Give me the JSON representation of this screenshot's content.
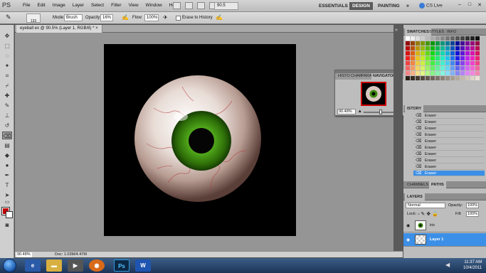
{
  "app": {
    "logo": "PS"
  },
  "menu": [
    "File",
    "Edit",
    "Image",
    "Layer",
    "Select",
    "Filter",
    "View",
    "Window",
    "Help"
  ],
  "zoom_display": "90.5",
  "workspaces": {
    "essentials": "ESSENTIALS",
    "design": "DESIGN",
    "painting": "PAINTING",
    "more": "»"
  },
  "cs_live": "CS Live",
  "window_controls": [
    "–",
    "□",
    "✕"
  ],
  "options": {
    "brush_size": "133",
    "mode_label": "Mode:",
    "mode_value": "Brush",
    "opacity_label": "Opacity:",
    "opacity_value": "16%",
    "flow_label": "Flow:",
    "flow_value": "100%",
    "erase_history_label": "Erase to History"
  },
  "document": {
    "tab_title": "eyeball ex @ 90.5% (Layer 1, RGB/8) *",
    "close": "×",
    "status_zoom": "90.48%",
    "status_doc": "Doc: 1.03M/4.47M"
  },
  "navigator": {
    "tabs": [
      "HISTO",
      "CHAR",
      "PARA",
      "NAVIGATOR"
    ],
    "zoom_value": "90.48%"
  },
  "swatches_panel": {
    "tabs": [
      "SWATCHES",
      "STYLES",
      "INFO"
    ]
  },
  "history_panel": {
    "title": "ISTORY",
    "items": [
      "Eraser",
      "Eraser",
      "Eraser",
      "Eraser",
      "Eraser",
      "Eraser",
      "Eraser",
      "Eraser",
      "Eraser",
      "Eraser"
    ]
  },
  "channels_panel": {
    "tabs": [
      "CHANNELS",
      "PATHS"
    ]
  },
  "layers_panel": {
    "title": "LAYERS",
    "blend_mode": "Normal",
    "opacity_label": "Opacity:",
    "opacity_value": "100%",
    "lock_label": "Lock:",
    "fill_label": "Fill:",
    "fill_value": "100%",
    "layers": [
      {
        "name": "iris",
        "active": false
      },
      {
        "name": "Layer 1",
        "active": true
      }
    ]
  },
  "taskbar": {
    "time": "11:37 AM",
    "date": "10/4/2011",
    "ps_label": "Ps",
    "word_label": "W"
  },
  "colors": {
    "foreground": "#c00000",
    "background": "#ffffff",
    "accent": "#3c8fe6",
    "iris": "#3b8a0f"
  }
}
